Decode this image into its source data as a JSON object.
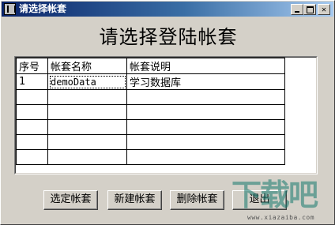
{
  "window": {
    "title": "请选择帐套"
  },
  "heading": "请选择登陆帐套",
  "table": {
    "columns": [
      "序号",
      "帐套名称",
      "帐套说明"
    ],
    "rows": [
      [
        "1",
        "demoData",
        "学习数据库"
      ],
      [
        "",
        "",
        ""
      ],
      [
        "",
        "",
        ""
      ],
      [
        "",
        "",
        ""
      ],
      [
        "",
        "",
        ""
      ],
      [
        "",
        "",
        ""
      ]
    ]
  },
  "buttons": {
    "select": "选定帐套",
    "new": "新建帐套",
    "delete": "删除帐套",
    "exit": "退出"
  },
  "watermark": {
    "main": "下载吧",
    "sub": "www.xiazaiba.com"
  }
}
